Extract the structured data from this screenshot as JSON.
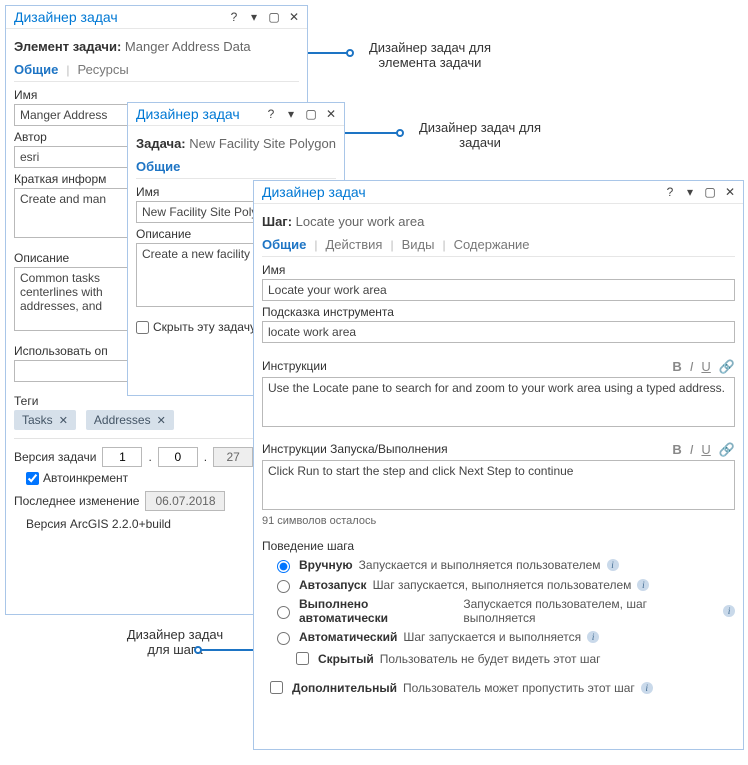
{
  "annotations": {
    "element": {
      "l1": "Дизайнер задач для",
      "l2": "элемента задачи"
    },
    "task": {
      "l1": "Дизайнер задач для",
      "l2": "задачи"
    },
    "step": {
      "l1": "Дизайнер задач",
      "l2": "для  шага"
    }
  },
  "element_panel": {
    "title": "Дизайнер задач",
    "crumb_label": "Элемент задачи:",
    "crumb_value": "Manger Address Data",
    "tabs": {
      "general": "Общие",
      "resources": "Ресурсы"
    },
    "name_lbl": "Имя",
    "name_val": "Manger Address",
    "author_lbl": "Автор",
    "author_val": "esri",
    "brief_lbl": "Краткая информ",
    "brief_val": "Create and man",
    "desc_lbl": "Описание",
    "desc_val": "Common tasks\ncenterlines with\naddresses, and",
    "useopts_lbl": "Использовать оп",
    "tags_lbl": "Теги",
    "tag1": "Tasks",
    "tag2": "Addresses",
    "version_lbl": "Версия задачи",
    "v1": "1",
    "v2": "0",
    "v3": "27",
    "autoinc": "Автоинкремент",
    "lastmod_lbl": "Последнее изменение",
    "lastmod_val": "06.07.2018",
    "arcgis": "Версия ArcGIS 2.2.0+build",
    "help": "?",
    "dd": "▾",
    "max": "▢",
    "close": "✕"
  },
  "task_panel": {
    "title": "Дизайнер задач",
    "crumb_label": "Задача:",
    "crumb_value": "New Facility Site Polygon",
    "tabs": {
      "general": "Общие"
    },
    "name_lbl": "Имя",
    "name_val": "New Facility Site Polyg",
    "desc_lbl": "Описание",
    "desc_val": "Create a new facility s",
    "hide": "Скрыть эту задачу"
  },
  "step_panel": {
    "title": "Дизайнер задач",
    "crumb_label": "Шаг:",
    "crumb_value": "Locate your work area",
    "tabs": {
      "general": "Общие",
      "actions": "Действия",
      "views": "Виды",
      "content": "Содержание"
    },
    "name_lbl": "Имя",
    "name_val": "Locate your work area",
    "tooltip_lbl": "Подсказка инструмента",
    "tooltip_val": "locate work area",
    "instr_lbl": "Инструкции",
    "instr_val": "Use the Locate pane to search for and zoom to your work area using a typed address.",
    "run_lbl": "Инструкции Запуска/Выполнения",
    "run_val": "Click Run to start the step and click Next Step to continue",
    "chars_left": "91 символов осталось",
    "behavior_lbl": "Поведение шага",
    "behaviors": {
      "manual": {
        "lab": "Вручную",
        "desc": "Запускается и выполняется пользователем"
      },
      "autostart": {
        "lab": "Автозапуск",
        "desc": "Шаг запускается, выполняется пользователем"
      },
      "autodone": {
        "lab": "Выполнено автоматически",
        "desc": "Запускается пользователем, шаг выполняется"
      },
      "auto": {
        "lab": "Автоматический",
        "desc": "Шаг запускается и выполняется"
      },
      "hidden": {
        "lab": "Скрытый",
        "desc": "Пользователь не будет видеть этот шаг"
      }
    },
    "optional": {
      "lab": "Дополнительный",
      "desc": "Пользователь может пропустить этот шаг"
    },
    "bold": "B",
    "italic": "I",
    "uline": "U",
    "link": "🔗"
  }
}
